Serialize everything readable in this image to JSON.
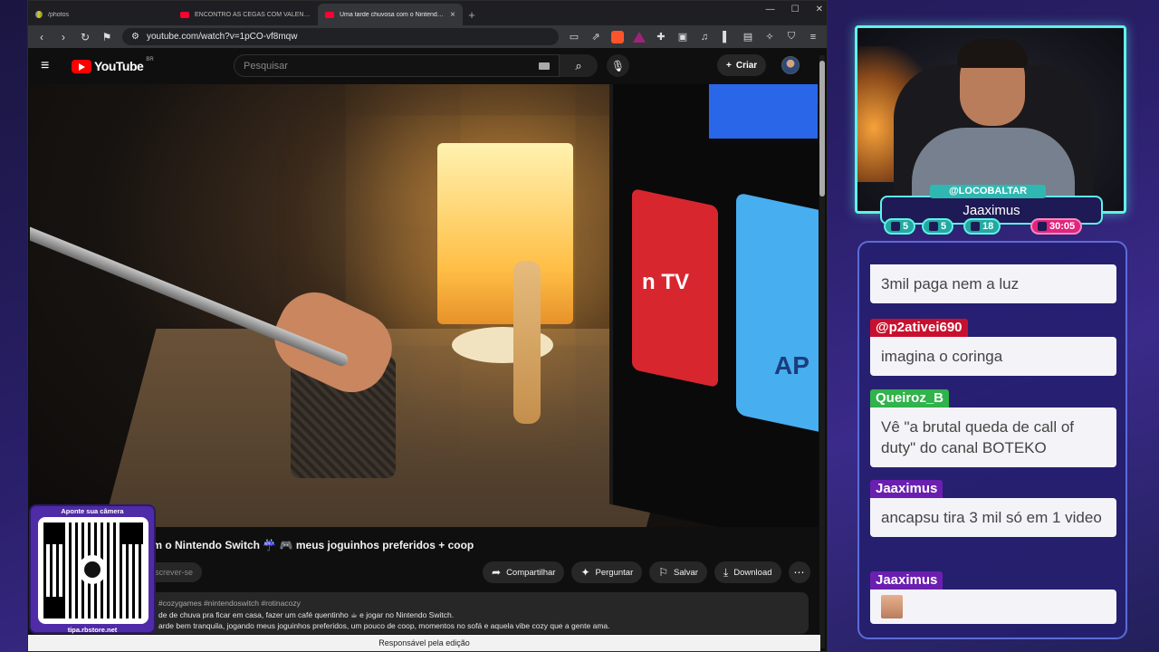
{
  "browser": {
    "tabs": [
      {
        "label": "/photos",
        "active": false
      },
      {
        "label": "ENCONTRO ÀS CEGAS COM VALENTINA BA...",
        "active": false
      },
      {
        "label": "Uma tarde chuvosa com o Nintendo S...",
        "active": true
      }
    ],
    "url": "youtube.com/watch?v=1pCO-vf8mqw"
  },
  "youtube": {
    "logo_text": "YouTube",
    "country": "BR",
    "search_placeholder": "Pesquisar",
    "create_label": "Criar",
    "video_title": "om o Nintendo Switch ☔️ 🎮 meus joguinhos preferidos + coop",
    "subscribe_label": "screver-se",
    "actions": {
      "share": "Compartilhar",
      "ask": "Perguntar",
      "save": "Salvar",
      "download": "Download"
    },
    "description": {
      "tags": "#cozygames #nintendoswitch #rotinacozy",
      "line1": "de de chuva pra ficar em casa, fazer um café quentinho ☕ e jogar no Nintendo Switch.",
      "line2": "arde bem tranquila, jogando meus joguinhos preferidos, um pouco de coop, momentos no sofá e aquela vibe cozy que a gente ama."
    },
    "footer": "Responsável pela edição",
    "video_overlay": {
      "tv_text": "n TV",
      "ap_text": "AP"
    }
  },
  "qr": {
    "title": "Aponte sua câmera",
    "url": "tipa.rbstore.net"
  },
  "stream": {
    "handle": "@LOCOBALTAR",
    "name": "Jaaximus",
    "stats": [
      {
        "icon": "twitch-icon",
        "value": "5"
      },
      {
        "icon": "youtube-icon",
        "value": "5"
      },
      {
        "icon": "kick-icon",
        "value": "18"
      }
    ],
    "timer": "30:05"
  },
  "chat": [
    {
      "user": "",
      "text": "3mil paga nem a luz",
      "color": "#c8102e"
    },
    {
      "user": "@p2ativei690",
      "text": "imagina o coringa",
      "color": "#c8102e"
    },
    {
      "user": "Queiroz_B",
      "text": "Vê \"a brutal queda de call of duty\" do canal BOTEKO",
      "color": "#2fb34a"
    },
    {
      "user": "Jaaximus",
      "text": "ancapsu tira 3 mil só em 1 video",
      "color": "#6b1fb0"
    },
    {
      "user": "Jaaximus",
      "text": "",
      "color": "#6b1fb0"
    }
  ]
}
